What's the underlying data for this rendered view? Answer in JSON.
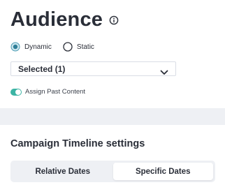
{
  "audience": {
    "title": "Audience",
    "info_icon": "info-icon",
    "radio_options": [
      {
        "label": "Dynamic",
        "selected": true
      },
      {
        "label": "Static",
        "selected": false
      }
    ],
    "select": {
      "value": "Selected (1)",
      "icon": "chevron-down-icon"
    },
    "toggle": {
      "label": "Assign Past Content",
      "on": true
    }
  },
  "timeline": {
    "title": "Campaign Timeline settings",
    "tabs": [
      {
        "label": "Relative Dates",
        "active": false
      },
      {
        "label": "Specific Dates",
        "active": true
      }
    ]
  },
  "colors": {
    "accent": "#3cb4a4",
    "text": "#2a2e38",
    "band": "#eef0f4"
  }
}
